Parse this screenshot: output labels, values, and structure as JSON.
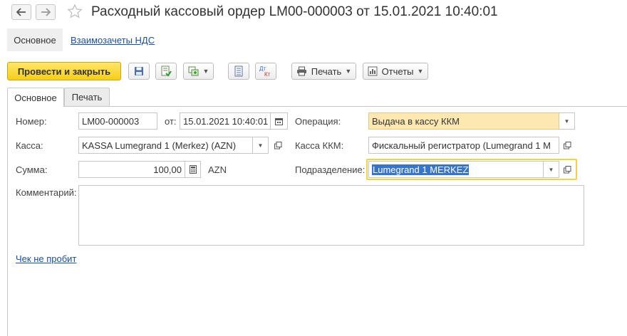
{
  "window": {
    "title": "Расходный кассовый ордер LM00-000003 от 15.01.2021 10:40:01"
  },
  "sections": {
    "main": "Основное",
    "vat_offsets": "Взаимозачеты НДС"
  },
  "toolbar": {
    "post_close": "Провести и закрыть",
    "print": "Печать",
    "reports": "Отчеты"
  },
  "form_tabs": {
    "main": "Основное",
    "print": "Печать"
  },
  "form": {
    "number_label": "Номер:",
    "number_value": "LM00-000003",
    "date_label": "от:",
    "date_value": "15.01.2021 10:40:01",
    "operation_label": "Операция:",
    "operation_value": "Выдача в кассу ККМ",
    "cashbox_label": "Касса:",
    "cashbox_value": "KASSA Lumegrand 1 (Merkez) (AZN)",
    "kkm_label": "Касса ККМ:",
    "kkm_value": "Фискальный регистратор (Lumegrand 1 M",
    "amount_label": "Сумма:",
    "amount_value": "100,00",
    "currency": "AZN",
    "department_label": "Подразделение:",
    "department_value": "Lumegrand 1 MERKEZ",
    "comment_label": "Комментарий:",
    "comment_value": ""
  },
  "footer": {
    "receipt_link": "Чек не пробит"
  }
}
